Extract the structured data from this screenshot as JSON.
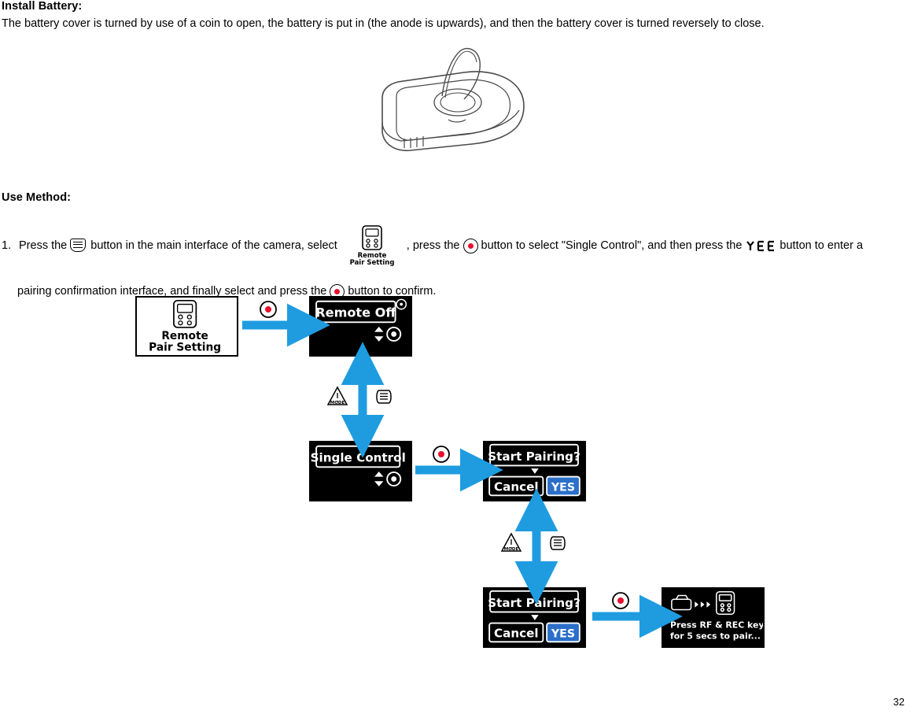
{
  "document": {
    "page_number": "32",
    "sections": [
      {
        "heading": "Install Battery:",
        "text": "The battery cover is turned by use of a coin to open, the battery is put in (the anode is upwards), and then the battery cover is turned reversely to close."
      },
      {
        "heading": "Use Method:"
      }
    ],
    "step1": {
      "number": "1.",
      "part1": "Press the",
      "part2": "button in the main interface of the camera, select",
      "part3": ", press the",
      "part4": "button to select \"Single Control\", and then press the",
      "part5": "button to enter a",
      "part6": "pairing confirmation interface, and finally select  and press the",
      "part7": "button to confirm."
    },
    "icons": {
      "menu": "menu-button-icon",
      "rec": "rec-button-icon",
      "remote_pair_setting": "remote-pair-setting-icon",
      "yes": "yes-button-icon",
      "mode": "mode-button-icon",
      "up_down": "up-down-arrows-icon",
      "ok_wheel": "ok-wheel-icon",
      "camera": "camera-icon",
      "remote": "remote-icon"
    },
    "diagram": {
      "screens": [
        {
          "id": "remote-pair-setting",
          "line1": "Remote",
          "line2": "Pair Setting",
          "style": "white"
        },
        {
          "id": "remote-off",
          "title": "Remote Off",
          "style": "black"
        },
        {
          "id": "single-control",
          "title": "Single Control",
          "style": "black"
        },
        {
          "id": "start-pairing-1",
          "title": "Start Pairing?",
          "cancel": "Cancel",
          "yes": "YES",
          "style": "black"
        },
        {
          "id": "start-pairing-2",
          "title": "Start Pairing?",
          "cancel": "Cancel",
          "yes": "YES",
          "style": "black"
        },
        {
          "id": "press-rf-rec",
          "line1": "Press RF & REC keys",
          "line2": "for 5 secs to pair...",
          "style": "black"
        }
      ],
      "button_labels": {
        "mode": "MODE"
      }
    }
  }
}
